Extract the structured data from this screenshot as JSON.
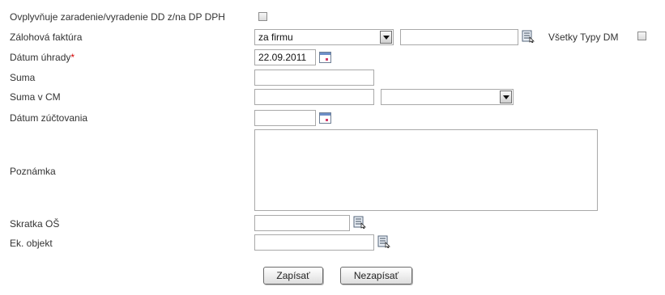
{
  "form": {
    "affects_label": "Ovplyvňuje zaradenie/vyradenie DD z/na DP DPH",
    "affects_checked": false,
    "advance_invoice_label": "Zálohová faktúra",
    "advance_invoice_select": "za firmu",
    "advance_invoice_lookup_value": "",
    "all_dm_types_label": "Všetky Typy DM",
    "all_dm_types_checked": false,
    "payment_date_label": "Dátum úhrady",
    "required_mark": "*",
    "payment_date_value": "22.09.2011",
    "amount_label": "Suma",
    "amount_value": "",
    "amount_cm_label": "Suma v CM",
    "amount_cm_value": "",
    "currency_select": "",
    "booking_date_label": "Dátum zúčtovania",
    "booking_date_value": "",
    "note_label": "Poznámka",
    "note_value": "",
    "os_abbrev_label": "Skratka OŠ",
    "os_abbrev_value": "",
    "ek_object_label": "Ek. objekt",
    "ek_object_value": ""
  },
  "buttons": {
    "save": "Zapísať",
    "cancel": "Nezapísať"
  },
  "icons": {
    "lookup": "lookup-list-icon",
    "calendar": "calendar-icon",
    "dropdown": "chevron-down-icon"
  }
}
